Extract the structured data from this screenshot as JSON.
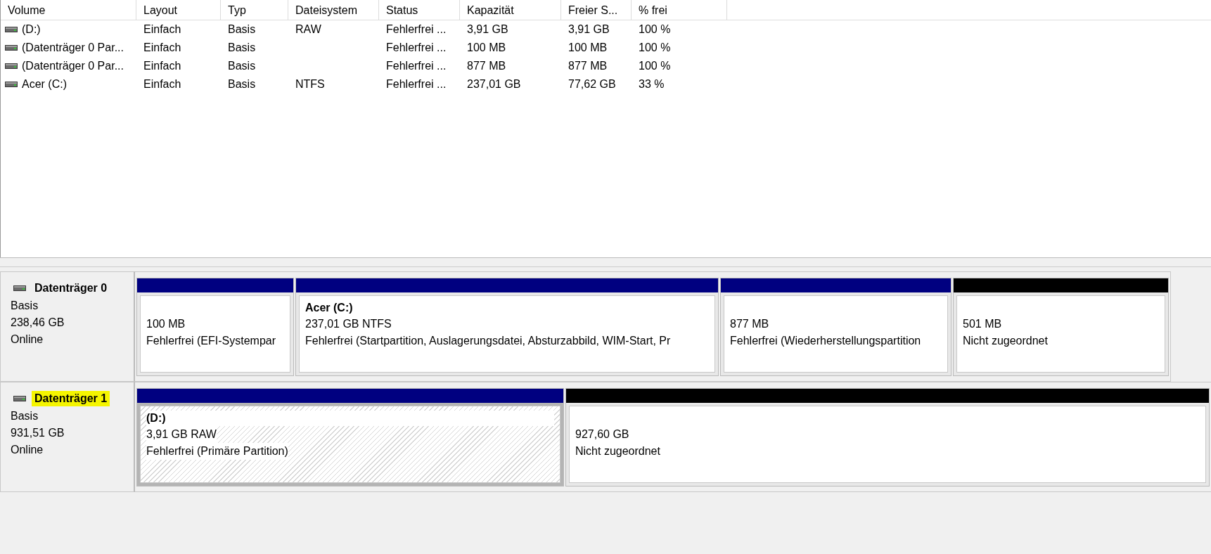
{
  "table": {
    "columns": [
      "Volume",
      "Layout",
      "Typ",
      "Dateisystem",
      "Status",
      "Kapazität",
      "Freier S...",
      "% frei"
    ],
    "rows": [
      {
        "cells": [
          "(D:)",
          "Einfach",
          "Basis",
          "RAW",
          "Fehlerfrei ...",
          "3,91 GB",
          "3,91 GB",
          "100 %"
        ]
      },
      {
        "cells": [
          "(Datenträger 0 Par...",
          "Einfach",
          "Basis",
          "",
          "Fehlerfrei ...",
          "100 MB",
          "100 MB",
          "100 %"
        ]
      },
      {
        "cells": [
          "(Datenträger 0 Par...",
          "Einfach",
          "Basis",
          "",
          "Fehlerfrei ...",
          "877 MB",
          "877 MB",
          "100 %"
        ]
      },
      {
        "cells": [
          "Acer (C:)",
          "Einfach",
          "Basis",
          "NTFS",
          "Fehlerfrei ...",
          "237,01 GB",
          "77,62 GB",
          "33 %"
        ]
      }
    ]
  },
  "disks": [
    {
      "name": "Datenträger 0",
      "highlighted": false,
      "type": "Basis",
      "size": "238,46 GB",
      "status": "Online",
      "partitions": [
        {
          "kind": "primary",
          "selected": false,
          "lines": [
            "100 MB",
            "Fehlerfrei (EFI-Systempar"
          ]
        },
        {
          "kind": "primary",
          "selected": false,
          "title": "Acer  (C:)",
          "lines": [
            "237,01 GB NTFS",
            "Fehlerfrei (Startpartition, Auslagerungsdatei, Absturzabbild, WIM-Start, Pr"
          ]
        },
        {
          "kind": "primary",
          "selected": false,
          "lines": [
            "877 MB",
            "Fehlerfrei (Wiederherstellungspartition"
          ]
        },
        {
          "kind": "unallocated",
          "selected": false,
          "lines": [
            "501 MB",
            "Nicht zugeordnet"
          ]
        }
      ]
    },
    {
      "name": "Datenträger 1",
      "highlighted": true,
      "type": "Basis",
      "size": "931,51 GB",
      "status": "Online",
      "partitions": [
        {
          "kind": "primary",
          "selected": true,
          "title": "(D:)",
          "lines": [
            "3,91 GB RAW",
            "Fehlerfrei (Primäre Partition)"
          ]
        },
        {
          "kind": "unallocated",
          "selected": false,
          "lines": [
            "927,60 GB",
            "Nicht zugeordnet"
          ]
        }
      ]
    }
  ]
}
